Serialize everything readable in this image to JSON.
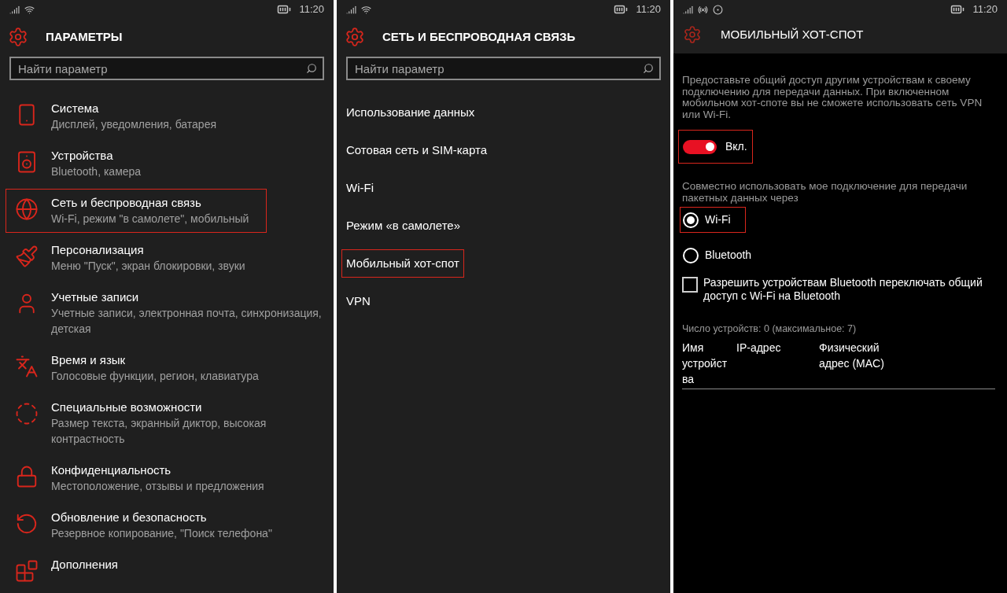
{
  "settings_screen": {
    "status_bar": {
      "time": "11:20"
    },
    "title": "ПАРАМЕТРЫ",
    "search": {
      "placeholder": "Найти параметр"
    },
    "items": [
      {
        "title": "Система",
        "subtitle": "Дисплей, уведомления, батарея",
        "highlighted": false
      },
      {
        "title": "Устройства",
        "subtitle": "Bluetooth, камера",
        "highlighted": false
      },
      {
        "title": "Сеть и беспроводная связь",
        "subtitle": "Wi-Fi, режим \"в самолете\", мобильный",
        "highlighted": true
      },
      {
        "title": "Персонализация",
        "subtitle": "Меню \"Пуск\", экран блокировки, звуки",
        "highlighted": false
      },
      {
        "title": "Учетные записи",
        "subtitle": "Учетные записи, электронная почта, синхронизация, детская",
        "highlighted": false
      },
      {
        "title": "Время и язык",
        "subtitle": "Голосовые функции, регион, клавиатура",
        "highlighted": false
      },
      {
        "title": "Специальные возможности",
        "subtitle": "Размер текста, экранный диктор, высокая контрастность",
        "highlighted": false
      },
      {
        "title": "Конфиденциальность",
        "subtitle": "Местоположение, отзывы и предложения",
        "highlighted": false
      },
      {
        "title": "Обновление и безопасность",
        "subtitle": "Резервное копирование, \"Поиск телефона\"",
        "highlighted": false
      },
      {
        "title": "Дополнения",
        "highlighted": false
      }
    ]
  },
  "network_screen": {
    "status_bar": {
      "time": "11:20"
    },
    "title": "СЕТЬ И БЕСПРОВОДНАЯ СВЯЗЬ",
    "search": {
      "placeholder": "Найти параметр"
    },
    "items": [
      {
        "label": "Использование данных",
        "highlighted": false
      },
      {
        "label": "Сотовая сеть и SIM-карта",
        "highlighted": false
      },
      {
        "label": "Wi-Fi",
        "highlighted": false
      },
      {
        "label": "Режим «в самолете»",
        "highlighted": false
      },
      {
        "label": "Мобильный хот-спот",
        "highlighted": true
      },
      {
        "label": "VPN",
        "highlighted": false
      }
    ]
  },
  "hotspot_screen": {
    "status_bar": {
      "time": "11:20"
    },
    "title": "МОБИЛЬНЫЙ ХОТ-СПОТ",
    "description": "Предоставьте общий доступ другим устройствам к своему подключению для передачи данных. При включенном мобильном хот-споте вы не сможете использовать сеть VPN или Wi-Fi.",
    "toggle": {
      "on": true,
      "label": "Вкл.",
      "highlighted": true
    },
    "share_label": "Совместно использовать мое подключение для передачи пакетных данных через",
    "radios": [
      {
        "label": "Wi-Fi",
        "selected": true,
        "highlighted": true
      },
      {
        "label": "Bluetooth",
        "selected": false,
        "highlighted": false
      }
    ],
    "checkbox": {
      "label": "Разрешить устройствам Bluetooth переключать общий доступ с Wi-Fi на Bluetooth",
      "checked": false
    },
    "devices_count": "Число устройств: 0 (максимальное: 7)",
    "table": {
      "columns": [
        "Имя устройства",
        "IP-адрес",
        "Физический адрес (MAC)"
      ]
    }
  }
}
